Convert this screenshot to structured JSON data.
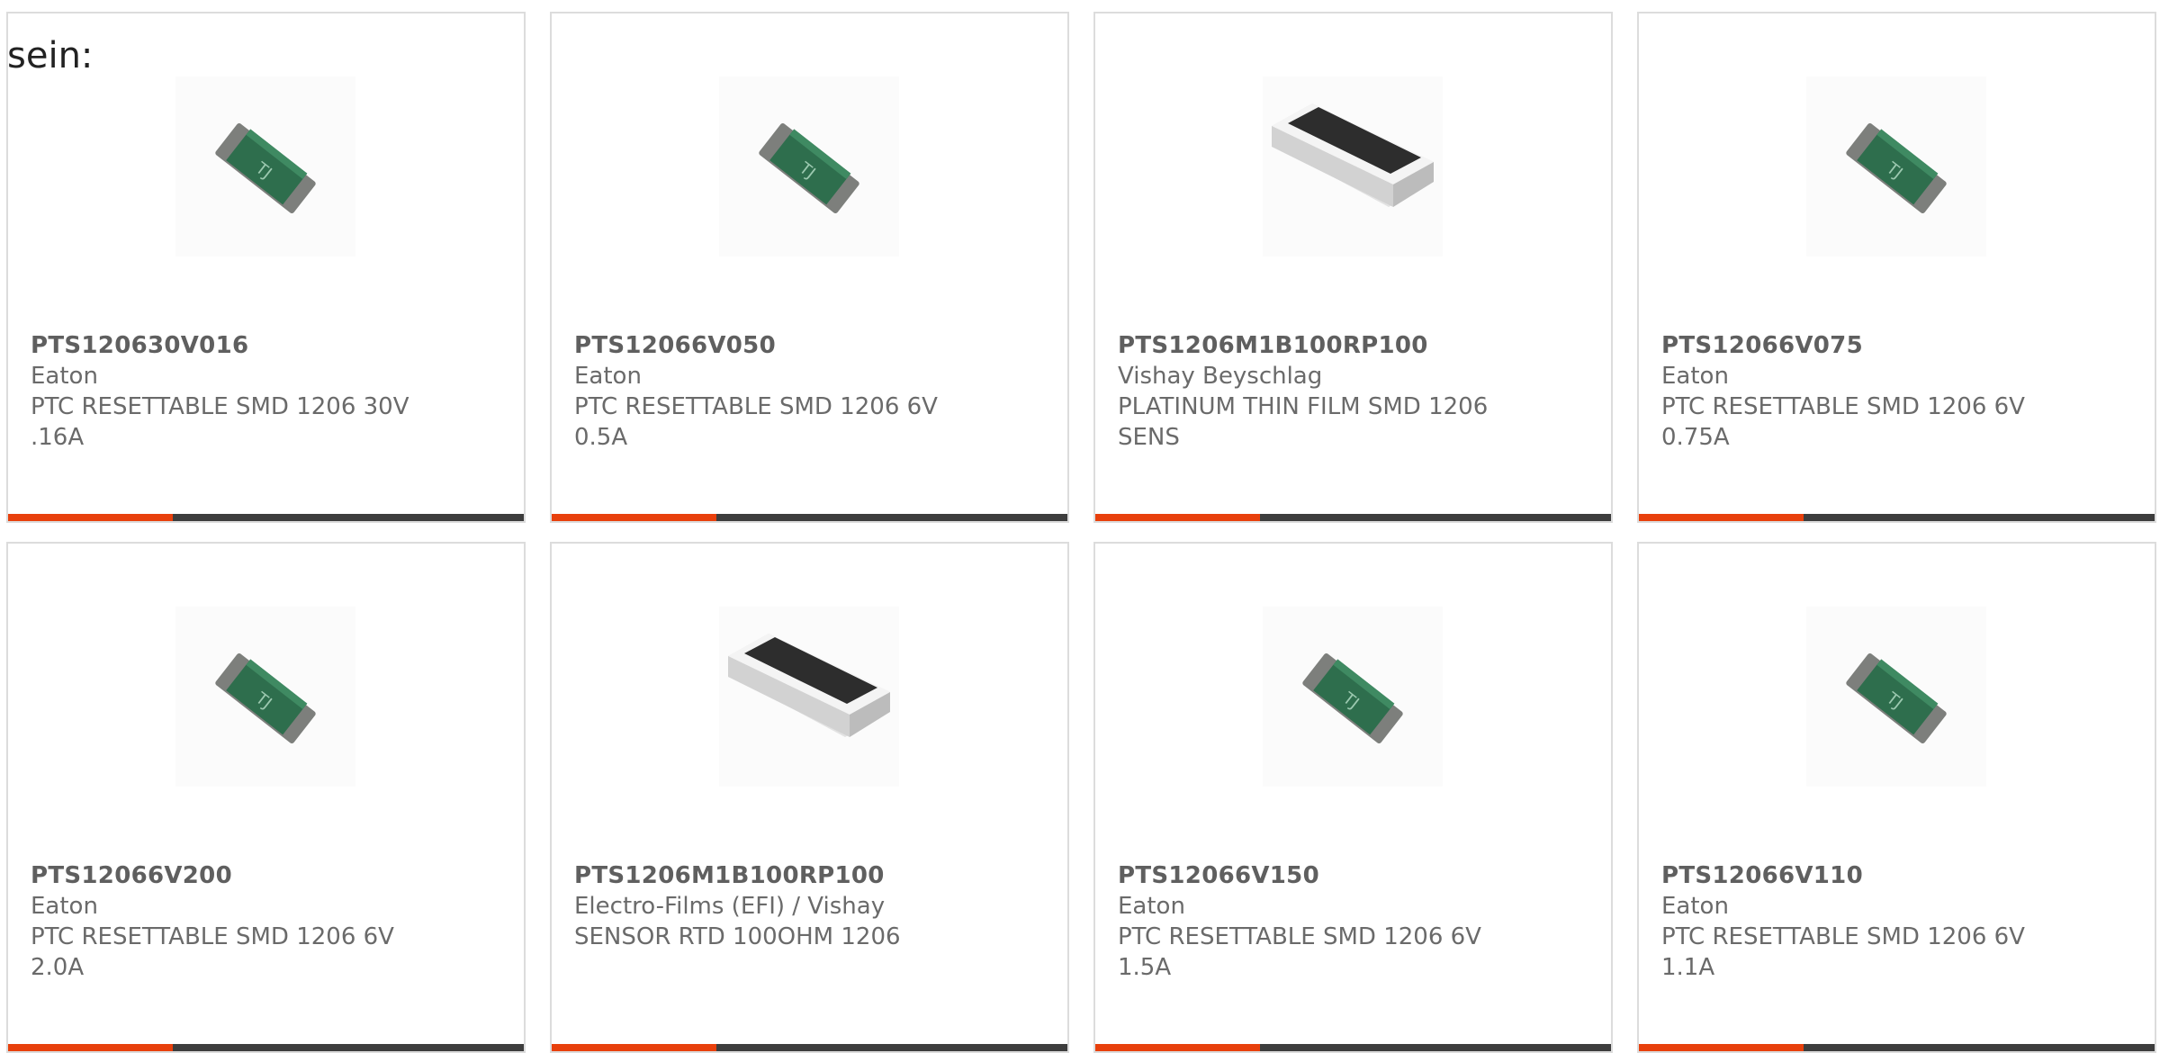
{
  "intro_text": "sein:",
  "colors": {
    "accent": "#e8400c",
    "bar": "#3d3d3d",
    "border": "#dcdcdc"
  },
  "products": [
    {
      "part_number": "PTS120630V016",
      "manufacturer": "Eaton",
      "description": "PTC RESETTABLE SMD 1206 30V .16A",
      "image": "ptc-fuse-chip-icon"
    },
    {
      "part_number": "PTS12066V050",
      "manufacturer": "Eaton",
      "description": "PTC RESETTABLE SMD 1206 6V 0.5A",
      "image": "ptc-fuse-chip-icon"
    },
    {
      "part_number": "PTS1206M1B100RP100",
      "manufacturer": "Vishay Beyschlag",
      "description": "PLATINUM THIN FILM SMD 1206 SENS",
      "image": "resistor-chip-icon"
    },
    {
      "part_number": "PTS12066V075",
      "manufacturer": "Eaton",
      "description": "PTC RESETTABLE SMD 1206 6V 0.75A",
      "image": "ptc-fuse-chip-icon"
    },
    {
      "part_number": "PTS12066V200",
      "manufacturer": "Eaton",
      "description": "PTC RESETTABLE SMD 1206 6V 2.0A",
      "image": "ptc-fuse-chip-icon"
    },
    {
      "part_number": "PTS1206M1B100RP100",
      "manufacturer": "Electro-Films (EFI) / Vishay",
      "description": "SENSOR RTD 100OHM 1206",
      "image": "resistor-chip-icon"
    },
    {
      "part_number": "PTS12066V150",
      "manufacturer": "Eaton",
      "description": "PTC RESETTABLE SMD 1206 6V 1.5A",
      "image": "ptc-fuse-chip-icon"
    },
    {
      "part_number": "PTS12066V110",
      "manufacturer": "Eaton",
      "description": "PTC RESETTABLE SMD 1206 6V 1.1A",
      "image": "ptc-fuse-chip-icon"
    }
  ]
}
